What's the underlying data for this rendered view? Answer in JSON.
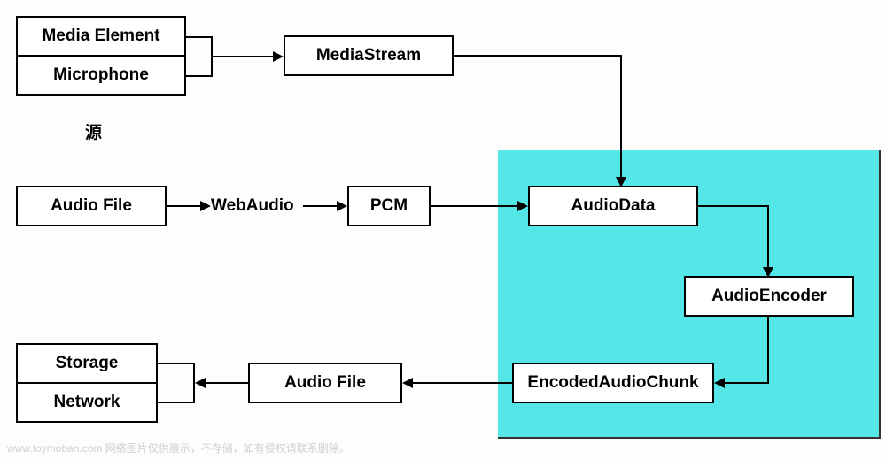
{
  "chart_data": {
    "type": "diagram",
    "nodes": [
      {
        "id": "media_element",
        "label": "Media Element"
      },
      {
        "id": "microphone",
        "label": "Microphone"
      },
      {
        "id": "media_stream",
        "label": "MediaStream"
      },
      {
        "id": "audio_file_src",
        "label": "Audio File"
      },
      {
        "id": "webaudio",
        "label": "WebAudio",
        "unboxed": true
      },
      {
        "id": "pcm",
        "label": "PCM"
      },
      {
        "id": "audio_data",
        "label": "AudioData",
        "highlighted": true
      },
      {
        "id": "audio_encoder",
        "label": "AudioEncoder",
        "highlighted": true
      },
      {
        "id": "encoded_chunk",
        "label": "EncodedAudioChunk",
        "highlighted": true
      },
      {
        "id": "audio_file_out",
        "label": "Audio File"
      },
      {
        "id": "storage",
        "label": "Storage"
      },
      {
        "id": "network",
        "label": "Network"
      }
    ],
    "edges": [
      {
        "from": "media_element",
        "to": "media_stream"
      },
      {
        "from": "microphone",
        "to": "media_stream"
      },
      {
        "from": "media_stream",
        "to": "audio_data"
      },
      {
        "from": "audio_file_src",
        "to": "webaudio"
      },
      {
        "from": "webaudio",
        "to": "pcm"
      },
      {
        "from": "pcm",
        "to": "audio_data"
      },
      {
        "from": "audio_data",
        "to": "audio_encoder"
      },
      {
        "from": "audio_encoder",
        "to": "encoded_chunk"
      },
      {
        "from": "encoded_chunk",
        "to": "audio_file_out"
      },
      {
        "from": "audio_file_out",
        "to": "storage"
      },
      {
        "from": "audio_file_out",
        "to": "network"
      }
    ],
    "annotations": {
      "source_label": "源"
    },
    "highlight_color": "#55e7e7"
  },
  "boxes": {
    "media_element": "Media Element",
    "microphone": "Microphone",
    "media_stream": "MediaStream",
    "audio_file_src": "Audio File",
    "webaudio": "WebAudio",
    "pcm": "PCM",
    "audio_data": "AudioData",
    "audio_encoder": "AudioEncoder",
    "encoded_chunk": "EncodedAudioChunk",
    "audio_file_out": "Audio File",
    "storage": "Storage",
    "network": "Network",
    "source_label": "源"
  },
  "watermark": "www.toymoban.com 网络图片仅供展示，不存储，如有侵权请联系删除。"
}
